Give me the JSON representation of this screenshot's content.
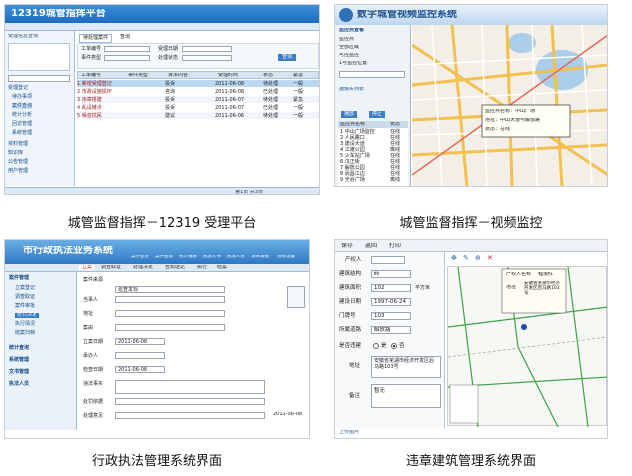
{
  "captions": [
    "城管监督指挥－12319 受理平台",
    "城管监督指挥－视频监控",
    "行政执法管理系统界面",
    "违章建筑管理系统界面"
  ],
  "s1": {
    "title": "12319城管指挥平台",
    "left_header": "受理信息查询",
    "tabs": [
      "待处理案件",
      "查询"
    ],
    "filters": {
      "l1": "工单编号",
      "l2": "受理日期",
      "l3": "事件类型",
      "l4": "处理状态",
      "v1": "",
      "btn": "查询"
    },
    "left_menu": [
      "受理登记",
      "待办事项",
      "案件查询",
      "统计分析",
      "回访管理",
      "系统管理",
      "资料管理",
      "知识库",
      "公告管理",
      "用户管理"
    ],
    "cols": [
      "工单编号",
      "事件类型",
      "诉求内容",
      "受理时间",
      "状态",
      "紧急"
    ],
    "rows": [
      [
        "1 新增受理登记",
        "投诉",
        "2011-06-08",
        "待处理",
        "一般"
      ],
      [
        "2 市政设施损坏",
        "咨询",
        "2011-06-08",
        "已处理",
        "一般"
      ],
      [
        "3 违章搭建",
        "投诉",
        "2011-06-07",
        "待处理",
        "紧急"
      ],
      [
        "4 乱设摊点",
        "投诉",
        "2011-06-07",
        "已处理",
        "一般"
      ],
      [
        "5 噪音扰民",
        "建议",
        "2011-06-06",
        "待处理",
        "一般"
      ]
    ],
    "status": "第1页 共3页"
  },
  "s2": {
    "title": "数字城管视频监控系统",
    "panel_title": "监控点查看",
    "panel_items": [
      "监控点",
      "全部区域",
      "可控监控",
      "1号监控位置",
      "摄像头列表"
    ],
    "list_head": [
      "监控点名称",
      "状态"
    ],
    "list": [
      [
        "1 中山广场监控",
        "在线"
      ],
      [
        "2 人民路口",
        "在线"
      ],
      [
        "3 建设大道",
        "在线"
      ],
      [
        "4 江滩公园",
        "离线"
      ],
      [
        "5 火车站广场",
        "在线"
      ],
      [
        "6 汉正街",
        "在线"
      ],
      [
        "7 解放公园",
        "在线"
      ],
      [
        "8 武昌江边",
        "在线"
      ],
      [
        "9 光谷广场",
        "离线"
      ],
      [
        "10 中南路",
        "在线"
      ]
    ],
    "buttons": [
      "播放",
      "停止"
    ],
    "popup": [
      "监控点名称：中山广场",
      "地址：中山大道与解放路",
      "状态：在线"
    ]
  },
  "s3": {
    "title": "市行政执法业务系统",
    "toolbar": [
      "案件登记",
      "案件查询",
      "统计报表",
      "执法文书",
      "执法人员",
      "法律法规",
      "系统设置"
    ],
    "tabs": [
      "立案",
      "调查取证",
      "处理决定",
      "告知送达",
      "执行",
      "结案"
    ],
    "left_menu": [
      "案件管理",
      "立案登记",
      "调查取证",
      "案件审批",
      "处罚决定",
      "执行情况",
      "结案归档",
      "统计查询",
      "系统管理",
      "文书管理",
      "执法人员"
    ],
    "labels": [
      "案件来源",
      "当事人",
      "地址",
      "案由",
      "立案日期",
      "承办人",
      "检查日期",
      "违法事实",
      "处罚依据",
      "处理意见"
    ],
    "values": [
      "巡查发现",
      "",
      "",
      "",
      "2011-06-08",
      "",
      "2011-06-08",
      "",
      "",
      ""
    ],
    "button": "保存",
    "status": "2011-06-08"
  },
  "s4": {
    "toolbar": [
      "保存",
      "返回",
      "打印"
    ],
    "labels": [
      "产权人",
      "建筑结构",
      "建筑面积",
      "建设日期",
      "门牌号",
      "所属道路",
      "是否违建",
      "地址",
      "备注"
    ],
    "values": [
      "",
      "砖",
      "102",
      "1997-06-24",
      "103",
      "解放路",
      "",
      "安徽省芜湖市经济开发区后马路103号",
      "暂无"
    ],
    "units": "平方米",
    "radio": [
      "是",
      "否"
    ],
    "popup": {
      "l1": "产权人名称",
      "v1": "程淑红",
      "l2": "地址",
      "v2": "安徽省芜湖市经济开发区后马路103号"
    },
    "footer": "上传图片"
  }
}
